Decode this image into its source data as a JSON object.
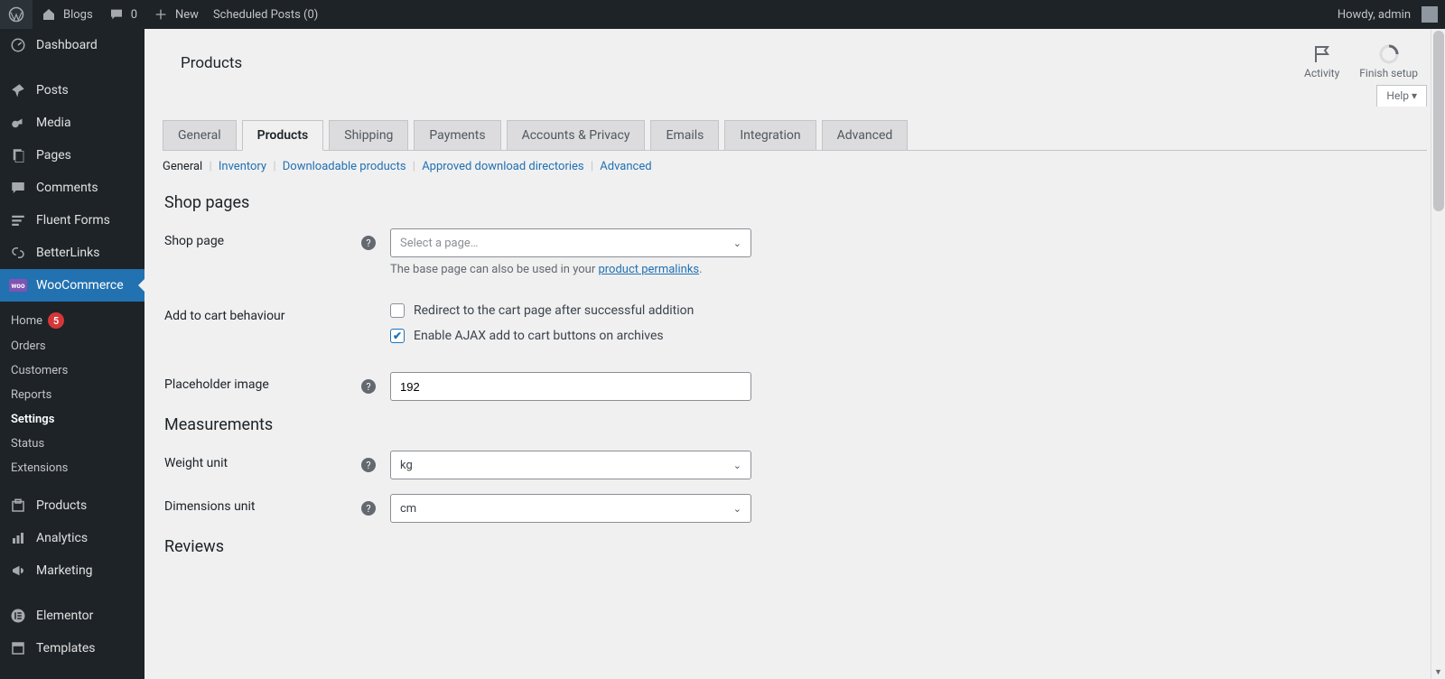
{
  "adminbar": {
    "site": "Blogs",
    "commentsCount": "0",
    "newLabel": "New",
    "scheduledPosts": "Scheduled Posts (0)",
    "howdy": "Howdy, admin"
  },
  "sidebar": {
    "items": {
      "dashboard": "Dashboard",
      "posts": "Posts",
      "media": "Media",
      "pages": "Pages",
      "comments": "Comments",
      "fluentForms": "Fluent Forms",
      "betterLinks": "BetterLinks",
      "woocommerce": "WooCommerce",
      "products": "Products",
      "analytics": "Analytics",
      "marketing": "Marketing",
      "elementor": "Elementor",
      "templates": "Templates"
    },
    "wooSub": {
      "home": "Home",
      "homeBadge": "5",
      "orders": "Orders",
      "customers": "Customers",
      "reports": "Reports",
      "settings": "Settings",
      "status": "Status",
      "extensions": "Extensions"
    },
    "wooBadge": "woo"
  },
  "header": {
    "pageTitle": "Products",
    "activity": "Activity",
    "finishSetup": "Finish setup",
    "help": "Help"
  },
  "tabs": {
    "general": "General",
    "products": "Products",
    "shipping": "Shipping",
    "payments": "Payments",
    "accountsPrivacy": "Accounts & Privacy",
    "emails": "Emails",
    "integration": "Integration",
    "advanced": "Advanced"
  },
  "subtabs": {
    "general": "General",
    "inventory": "Inventory",
    "downloadable": "Downloadable products",
    "approvedDirs": "Approved download directories",
    "advanced": "Advanced"
  },
  "sections": {
    "shopPages": {
      "title": "Shop pages",
      "shopPageLabel": "Shop page",
      "shopPagePlaceholder": "Select a page…",
      "shopPageDescPrefix": "The base page can also be used in your ",
      "shopPageDescLink": "product permalinks",
      "addToCartLabel": "Add to cart behaviour",
      "redirectOption": "Redirect to the cart page after successful addition",
      "ajaxOption": "Enable AJAX add to cart buttons on archives",
      "placeholderImageLabel": "Placeholder image",
      "placeholderImageValue": "192"
    },
    "measurements": {
      "title": "Measurements",
      "weightLabel": "Weight unit",
      "weightValue": "kg",
      "dimensionsLabel": "Dimensions unit",
      "dimensionsValue": "cm"
    },
    "reviews": {
      "title": "Reviews"
    }
  }
}
